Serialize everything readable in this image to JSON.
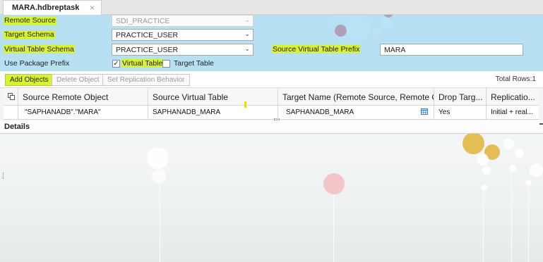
{
  "tab": {
    "title": "MARA.hdbreptask",
    "close": "×"
  },
  "form": {
    "remote_source_label": "Remote Source",
    "remote_source_value": "SDI_PRACTICE",
    "target_schema_label": "Target Schema",
    "target_schema_value": "PRACTICE_USER",
    "virtual_table_schema_label": "Virtual Table Schema",
    "virtual_table_schema_value": "PRACTICE_USER",
    "source_virtual_table_prefix_label": "Source Virtual Table Prefix",
    "source_virtual_table_prefix_value": "MARA",
    "use_package_prefix_label": "Use Package Prefix",
    "virtual_table_checkbox_label": "Virtual Table",
    "virtual_table_checked": true,
    "target_table_checkbox_label": "Target Table",
    "target_table_checked": false,
    "check_glyph": "✓",
    "caret_glyph": "⌄"
  },
  "toolbar": {
    "add_objects": "Add Objects",
    "delete_object": "Delete Object",
    "set_replication_behavior": "Set Replication Behavior",
    "total_rows": "Total Rows:1"
  },
  "table": {
    "columns": [
      "Source Remote Object",
      "Source Virtual Table",
      "Target Name (Remote Source, Remote O...",
      "Drop Targ...",
      "Replicatio..."
    ],
    "rows": [
      {
        "source_remote_object": "\"SAPHANADB\".\"MARA\"",
        "source_virtual_table": "SAPHANADB_MARA",
        "target_name": "SAPHANADB_MARA",
        "drop_target": "Yes",
        "replication": "Initial + real..."
      }
    ]
  },
  "details": {
    "title": "Details"
  },
  "colors": {
    "highlight": "#d7f233",
    "form_background": "#87cdf0",
    "accent_red": "#d9534f",
    "accent_gold": "#e0b437"
  },
  "icons": {
    "copy": "copy-icon",
    "calendar": "calendar-icon",
    "close": "close-icon",
    "dropdown": "chevron-down-icon"
  }
}
